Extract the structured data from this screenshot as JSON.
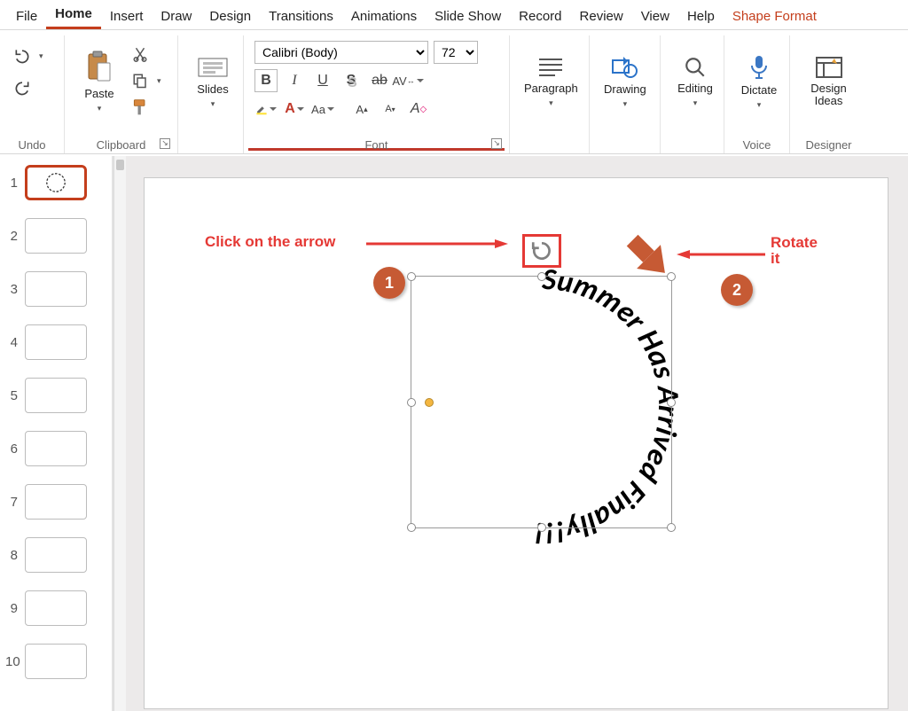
{
  "tabs": {
    "file": "File",
    "home": "Home",
    "insert": "Insert",
    "draw": "Draw",
    "design": "Design",
    "transitions": "Transitions",
    "animations": "Animations",
    "slideshow": "Slide Show",
    "record": "Record",
    "review": "Review",
    "view": "View",
    "help": "Help",
    "shapeformat": "Shape Format"
  },
  "ribbon": {
    "undo": "Undo",
    "clipboard": "Clipboard",
    "paste": "Paste",
    "slides": "Slides",
    "font": "Font",
    "font_name": "Calibri (Body)",
    "font_size": "72",
    "paragraph": "Paragraph",
    "drawing": "Drawing",
    "editing": "Editing",
    "dictate": "Dictate",
    "voice": "Voice",
    "designideas_l1": "Design",
    "designideas_l2": "Ideas",
    "designer": "Designer"
  },
  "thumbs": {
    "count": 10,
    "selected": 1
  },
  "slide": {
    "wordart_text": "Summer Has Arrived Finally!!!",
    "annot1": "Click on the arrow",
    "annot2_l1": "Rotate",
    "annot2_l2": "it",
    "badge1": "1",
    "badge2": "2"
  }
}
